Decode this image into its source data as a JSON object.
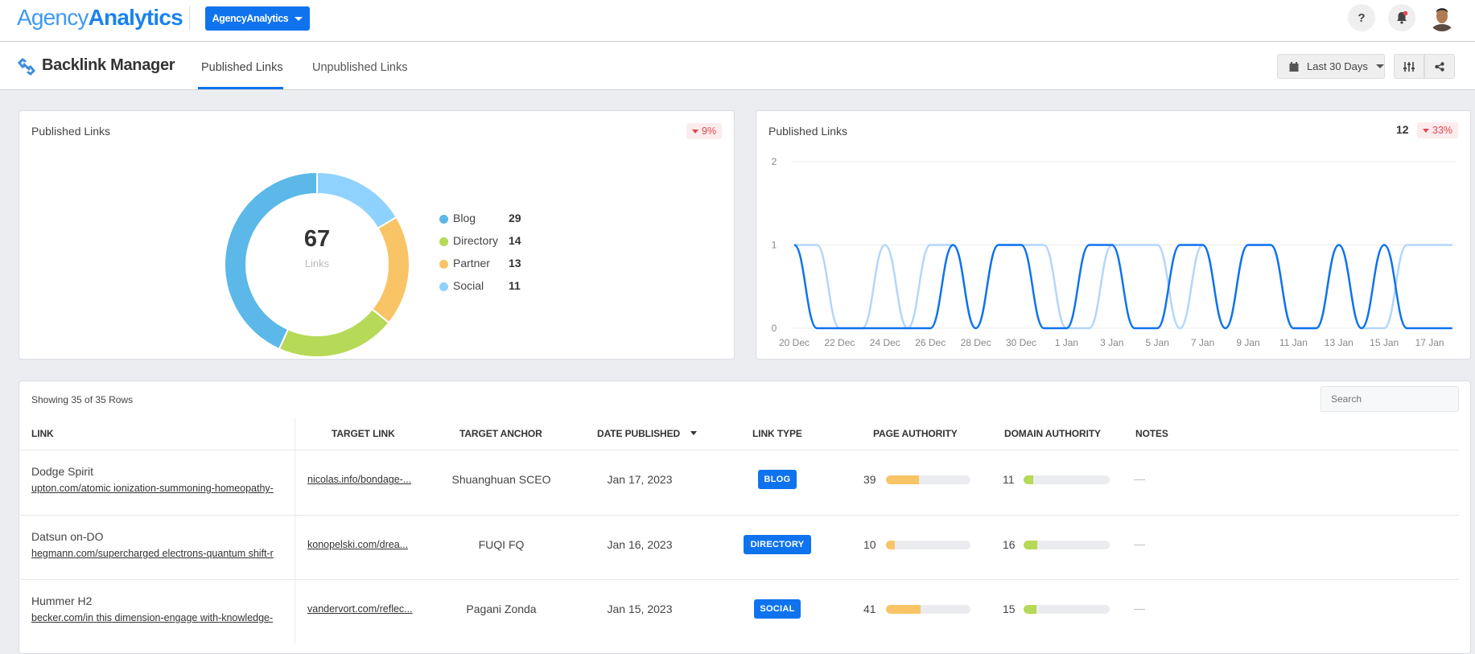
{
  "app": {
    "logo_light": "Agency",
    "logo_bold": "Analytics",
    "account_label": "AgencyAnalytics",
    "help_label": "?"
  },
  "page": {
    "title": "Backlink Manager",
    "tabs": [
      {
        "label": "Published Links",
        "active": true
      },
      {
        "label": "Unpublished Links",
        "active": false
      }
    ],
    "date_range": "Last 30 Days"
  },
  "colors": {
    "accent": "#0f73ee",
    "blog": "#5bb8e8",
    "directory": "#b6d957",
    "partner": "#f9c466",
    "social": "#8fd2fd",
    "negative": "#e0474f"
  },
  "donut_card": {
    "title": "Published Links",
    "change": "9%",
    "change_direction": "down",
    "total": "67",
    "total_label": "Links"
  },
  "line_card": {
    "title": "Published Links",
    "value": "12",
    "change": "33%",
    "change_direction": "down"
  },
  "chart_data": [
    {
      "type": "pie",
      "variant": "donut",
      "categories": [
        "Blog",
        "Directory",
        "Partner",
        "Social"
      ],
      "values": [
        29,
        14,
        13,
        11
      ],
      "legend": "right"
    },
    {
      "type": "line",
      "x": [
        "20 Dec",
        "21 Dec",
        "22 Dec",
        "23 Dec",
        "24 Dec",
        "25 Dec",
        "26 Dec",
        "27 Dec",
        "28 Dec",
        "29 Dec",
        "30 Dec",
        "31 Dec",
        "1 Jan",
        "2 Jan",
        "3 Jan",
        "4 Jan",
        "5 Jan",
        "6 Jan",
        "7 Jan",
        "8 Jan",
        "9 Jan",
        "10 Jan",
        "11 Jan",
        "12 Jan",
        "13 Jan",
        "14 Jan",
        "15 Jan",
        "16 Jan",
        "17 Jan",
        "18 Jan"
      ],
      "xticks": [
        "20 Dec",
        "22 Dec",
        "24 Dec",
        "26 Dec",
        "28 Dec",
        "30 Dec",
        "1 Jan",
        "3 Jan",
        "5 Jan",
        "7 Jan",
        "9 Jan",
        "11 Jan",
        "13 Jan",
        "15 Jan",
        "17 Jan"
      ],
      "yticks": [
        "0",
        "1",
        "2"
      ],
      "ylim": [
        0,
        2
      ],
      "grid": true,
      "series": [
        {
          "color": "#0f73ee",
          "values": [
            1,
            0,
            0,
            0,
            0,
            0,
            0,
            1,
            0,
            1,
            1,
            0,
            0,
            1,
            1,
            0,
            0,
            1,
            1,
            0,
            1,
            1,
            0,
            0,
            1,
            0,
            1,
            0,
            0,
            0
          ]
        },
        {
          "color": "#b3d6fb",
          "values": [
            1,
            1,
            0,
            0,
            1,
            0,
            1,
            1,
            0,
            1,
            1,
            1,
            0,
            0,
            1,
            1,
            1,
            0,
            1,
            0,
            1,
            1,
            0,
            0,
            1,
            0,
            0,
            1,
            1,
            1
          ]
        }
      ]
    }
  ],
  "table": {
    "showing": "Showing 35 of 35 Rows",
    "search_placeholder": "Search",
    "columns": [
      "LINK",
      "TARGET LINK",
      "TARGET ANCHOR",
      "DATE PUBLISHED",
      "LINK TYPE",
      "PAGE AUTHORITY",
      "DOMAIN AUTHORITY",
      "NOTES"
    ],
    "rows": [
      {
        "title": "Dodge Spirit",
        "url": "upton.com/atomic ionization-summoning-homeopathy-",
        "target": "nicolas.info/bondage-...",
        "anchor": "Shuanghuan SCEO",
        "date": "Jan 17, 2023",
        "type": "BLOG",
        "pa": "39",
        "da": "11",
        "notes": "—"
      },
      {
        "title": "Datsun on-DO",
        "url": "hegmann.com/supercharged electrons-quantum shift-r",
        "target": "konopelski.com/drea...",
        "anchor": "FUQI FQ",
        "date": "Jan 16, 2023",
        "type": "DIRECTORY",
        "pa": "10",
        "da": "16",
        "notes": "—"
      },
      {
        "title": "Hummer H2",
        "url": "becker.com/in this dimension-engage with-knowledge-",
        "target": "vandervort.com/reflec...",
        "anchor": "Pagani Zonda",
        "date": "Jan 15, 2023",
        "type": "SOCIAL",
        "pa": "41",
        "da": "15",
        "notes": "—"
      }
    ]
  }
}
